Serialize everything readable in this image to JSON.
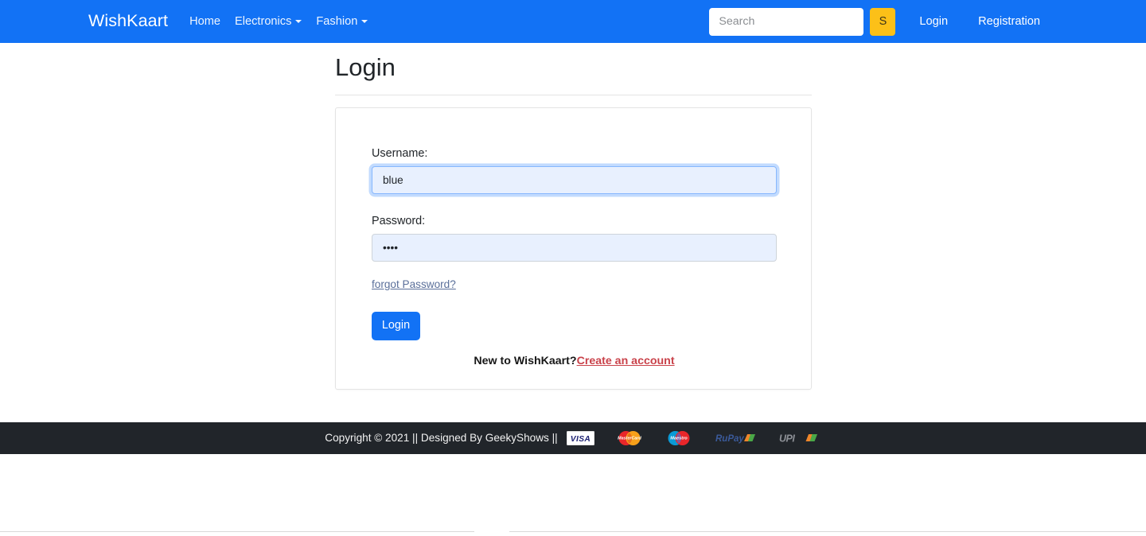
{
  "navbar": {
    "brand": "WishKaart",
    "links": [
      {
        "label": "Home",
        "has_caret": false,
        "icon": ""
      },
      {
        "label": "Electronics",
        "has_caret": true,
        "icon": "chevron-down-icon"
      },
      {
        "label": "Fashion",
        "has_caret": true,
        "icon": "chevron-down-icon"
      }
    ],
    "search": {
      "placeholder": "Search",
      "value": "",
      "button_label": "S",
      "button_color": "#fcc018"
    },
    "auth": {
      "login": "Login",
      "registration": "Registration"
    },
    "background_color": "#1272f5"
  },
  "main": {
    "page_title": "Login",
    "form": {
      "username": {
        "label": "Username:",
        "value": "blue",
        "placeholder": "",
        "focused": true
      },
      "password": {
        "label": "Password:",
        "value": "••••",
        "placeholder": "",
        "focused": false
      },
      "forgot_password_link": "forgot Password?",
      "submit_label": "Login",
      "signup_prompt": "New to WishKaart?",
      "signup_link": "Create an account",
      "signup_link_color": "#c9424a"
    }
  },
  "footer": {
    "copyright": "Copyright © 2021 || Designed By GeekyShows ||",
    "background_color": "#21252a",
    "payment_logos": [
      {
        "name": "visa-logo",
        "label": "VISA"
      },
      {
        "name": "mastercard-logo",
        "label": "MasterCard"
      },
      {
        "name": "maestro-logo",
        "label": "Maestro"
      },
      {
        "name": "rupay-logo",
        "label": "RuPay"
      },
      {
        "name": "upi-logo",
        "label": "UPI"
      }
    ]
  }
}
